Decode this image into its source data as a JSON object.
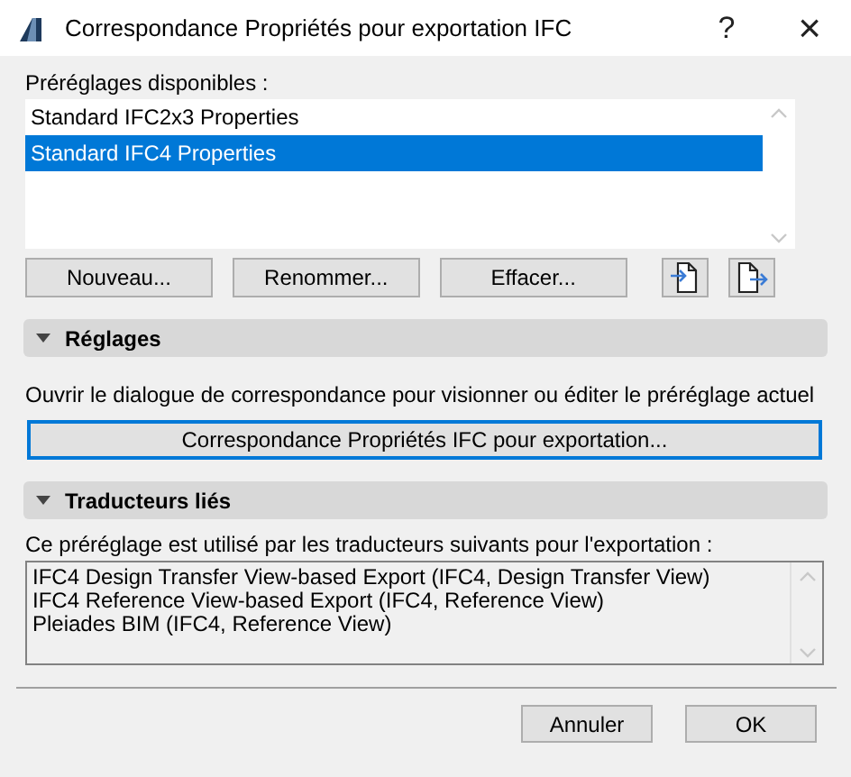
{
  "window": {
    "title": "Correspondance Propriétés pour exportation IFC",
    "help": "?",
    "close": "×"
  },
  "presets": {
    "label": "Préréglages disponibles :",
    "items": [
      {
        "label": "Standard IFC2x3 Properties",
        "selected": false
      },
      {
        "label": "Standard IFC4 Properties",
        "selected": true
      }
    ]
  },
  "preset_buttons": [
    "Nouveau...",
    "Renommer...",
    "Effacer..."
  ],
  "sections": [
    {
      "title": "Réglages",
      "expanded": true,
      "description": "Ouvrir le dialogue de correspondance pour visionner ou éditer le préréglage actuel",
      "button": "Correspondance Propriétés IFC pour exportation..."
    },
    {
      "title": "Traducteurs liés",
      "expanded": true,
      "description": "Ce préréglage est utilisé par les traducteurs suivants pour l'exportation :",
      "translators": [
        "IFC4 Design Transfer View-based Export (IFC4, Design Transfer View)",
        "IFC4 Reference View-based Export (IFC4, Reference View)",
        "Pleiades BIM (IFC4, Reference View)"
      ]
    }
  ],
  "footer_buttons": [
    "Annuler",
    "OK"
  ]
}
